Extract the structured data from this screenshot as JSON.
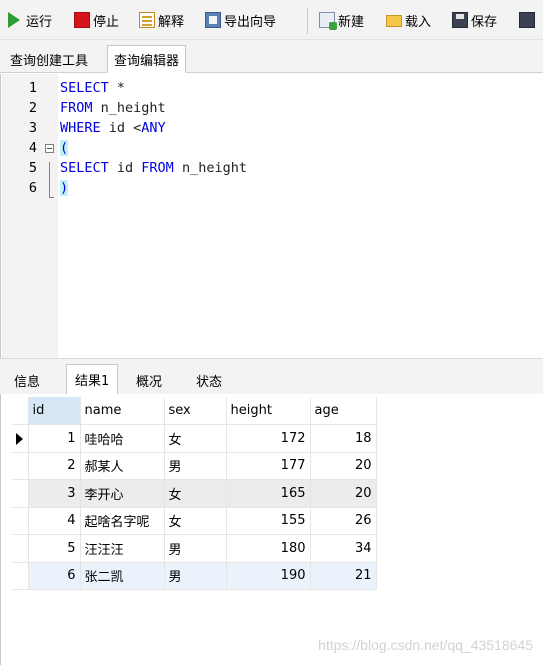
{
  "toolbar": {
    "run": "运行",
    "stop": "停止",
    "explain": "解释",
    "export_wizard": "导出向导",
    "new": "新建",
    "load": "载入",
    "save": "保存"
  },
  "editor_tabs": [
    "查询创建工具",
    "查询编辑器"
  ],
  "editor": {
    "line_numbers": [
      "1",
      "2",
      "3",
      "4",
      "5",
      "6"
    ],
    "lines": [
      {
        "kw": "SELECT",
        "rest": " *"
      },
      {
        "kw": "FROM",
        "rest": " n_height"
      },
      {
        "kw": "WHERE",
        "rest": " id <",
        "kw2": "ANY"
      },
      {
        "paren": "("
      },
      {
        "kw": "SELECT",
        "mid": " id ",
        "kw2": "FROM",
        "rest": " n_height"
      },
      {
        "paren": ")"
      }
    ]
  },
  "result_tabs": [
    "信息",
    "结果1",
    "概况",
    "状态"
  ],
  "result": {
    "columns": [
      "id",
      "name",
      "sex",
      "height",
      "age"
    ],
    "rows": [
      [
        "1",
        "哇哈哈",
        "女",
        "172",
        "18"
      ],
      [
        "2",
        "郝某人",
        "男",
        "177",
        "20"
      ],
      [
        "3",
        "李开心",
        "女",
        "165",
        "20"
      ],
      [
        "4",
        "起啥名字呢",
        "女",
        "155",
        "26"
      ],
      [
        "5",
        "汪汪汪",
        "男",
        "180",
        "34"
      ],
      [
        "6",
        "张二凯",
        "男",
        "190",
        "21"
      ]
    ]
  },
  "watermark": "https://blog.csdn.net/qq_43518645",
  "colors": {
    "keyword": "#0000e0",
    "paren_highlight": "#bff3f3",
    "selected_header": "#d6e6f5",
    "alt_row": "#ececec"
  }
}
